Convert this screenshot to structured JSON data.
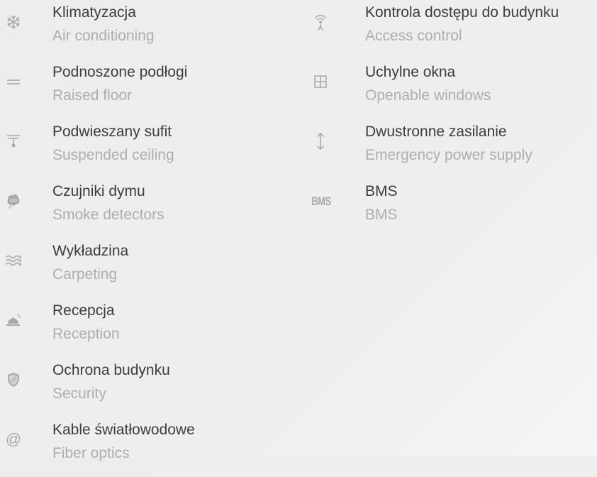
{
  "left_column": [
    {
      "icon": "snowflake-icon",
      "pl": "Klimatyzacja",
      "en": "Air conditioning"
    },
    {
      "icon": "raised-floor-icon",
      "pl": "Podnoszone podłogi",
      "en": "Raised floor"
    },
    {
      "icon": "suspended-ceiling-icon",
      "pl": "Podwieszany sufit",
      "en": "Suspended ceiling"
    },
    {
      "icon": "smoke-detector-icon",
      "pl": "Czujniki dymu",
      "en": "Smoke detectors"
    },
    {
      "icon": "carpet-waves-icon",
      "pl": "Wykładzina",
      "en": "Carpeting"
    },
    {
      "icon": "reception-bell-icon",
      "pl": "Recepcja",
      "en": "Reception"
    },
    {
      "icon": "shield-icon",
      "pl": "Ochrona budynku",
      "en": "Security"
    },
    {
      "icon": "at-sign-icon",
      "pl": "Kable światłowodowe",
      "en": "Fiber optics",
      "glyph": "@"
    }
  ],
  "right_column": [
    {
      "icon": "access-antenna-icon",
      "pl": "Kontrola dostępu do budynku",
      "en": "Access control"
    },
    {
      "icon": "window-grid-icon",
      "pl": "Uchylne okna",
      "en": "Openable windows"
    },
    {
      "icon": "up-down-arrow-icon",
      "pl": "Dwustronne zasilanie",
      "en": "Emergency power supply"
    },
    {
      "icon": "bms-icon",
      "pl": "BMS",
      "en": "BMS",
      "glyph": "BMS"
    }
  ],
  "colors": {
    "label": "#3d3d3d",
    "sublabel": "#aeaeae",
    "icon": "#a9a9a9",
    "background": "#eeeeee"
  }
}
